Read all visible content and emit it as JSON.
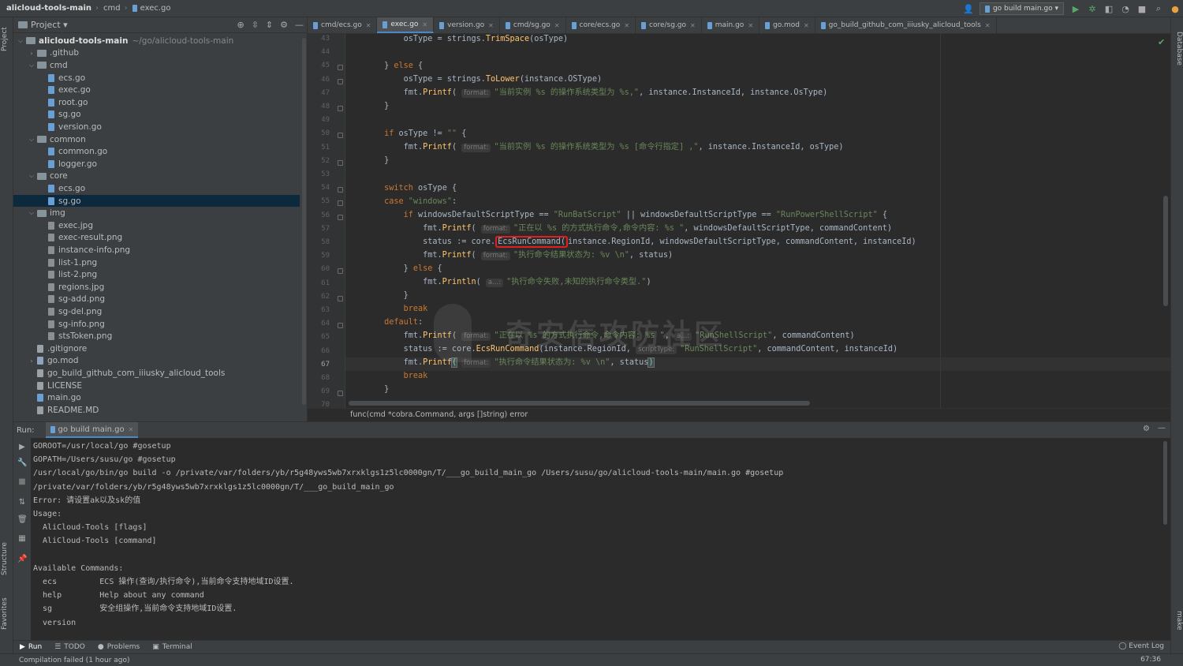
{
  "titlebar": {
    "project": "alicloud-tools-main",
    "folder": "cmd",
    "file": "exec.go",
    "run_config": "go build main.go"
  },
  "side": {
    "project_tab": "Project",
    "structure_tab": "Structure",
    "favorites_tab": "Favorites",
    "database_tab": "Database",
    "make_tab": "make"
  },
  "project_panel": {
    "title": "Project",
    "tree": [
      {
        "label": "alicloud-tools-main",
        "path": "~/go/alicloud-tools-main",
        "type": "folder",
        "depth": 0,
        "open": true
      },
      {
        "label": ".github",
        "type": "folder",
        "depth": 1,
        "open": false
      },
      {
        "label": "cmd",
        "type": "folder",
        "depth": 1,
        "open": true
      },
      {
        "label": "ecs.go",
        "type": "go",
        "depth": 2
      },
      {
        "label": "exec.go",
        "type": "go",
        "depth": 2
      },
      {
        "label": "root.go",
        "type": "go",
        "depth": 2
      },
      {
        "label": "sg.go",
        "type": "go",
        "depth": 2
      },
      {
        "label": "version.go",
        "type": "go",
        "depth": 2
      },
      {
        "label": "common",
        "type": "folder",
        "depth": 1,
        "open": true
      },
      {
        "label": "common.go",
        "type": "go",
        "depth": 2
      },
      {
        "label": "logger.go",
        "type": "go",
        "depth": 2
      },
      {
        "label": "core",
        "type": "folder",
        "depth": 1,
        "open": true
      },
      {
        "label": "ecs.go",
        "type": "go",
        "depth": 2
      },
      {
        "label": "sg.go",
        "type": "go",
        "depth": 2,
        "selected": true
      },
      {
        "label": "img",
        "type": "folder",
        "depth": 1,
        "open": true
      },
      {
        "label": "exec.jpg",
        "type": "img",
        "depth": 2
      },
      {
        "label": "exec-result.png",
        "type": "img",
        "depth": 2
      },
      {
        "label": "instance-info.png",
        "type": "img",
        "depth": 2
      },
      {
        "label": "list-1.png",
        "type": "img",
        "depth": 2
      },
      {
        "label": "list-2.png",
        "type": "img",
        "depth": 2
      },
      {
        "label": "regions.jpg",
        "type": "img",
        "depth": 2
      },
      {
        "label": "sg-add.png",
        "type": "img",
        "depth": 2
      },
      {
        "label": "sg-del.png",
        "type": "img",
        "depth": 2
      },
      {
        "label": "sg-info.png",
        "type": "img",
        "depth": 2
      },
      {
        "label": "stsToken.png",
        "type": "img",
        "depth": 2
      },
      {
        "label": ".gitignore",
        "type": "txt",
        "depth": 1
      },
      {
        "label": "go.mod",
        "type": "mod",
        "depth": 1,
        "open": false
      },
      {
        "label": "go_build_github_com_iiiusky_alicloud_tools",
        "type": "txt",
        "depth": 1
      },
      {
        "label": "LICENSE",
        "type": "txt",
        "depth": 1
      },
      {
        "label": "main.go",
        "type": "go",
        "depth": 1
      },
      {
        "label": "README.MD",
        "type": "txt",
        "depth": 1
      }
    ]
  },
  "tabs": [
    {
      "label": "cmd/ecs.go",
      "active": false
    },
    {
      "label": "exec.go",
      "active": true
    },
    {
      "label": "version.go",
      "active": false
    },
    {
      "label": "cmd/sg.go",
      "active": false
    },
    {
      "label": "core/ecs.go",
      "active": false
    },
    {
      "label": "core/sg.go",
      "active": false
    },
    {
      "label": "main.go",
      "active": false
    },
    {
      "label": "go.mod",
      "active": false
    },
    {
      "label": "go_build_github_com_iiiusky_alicloud_tools",
      "active": false
    }
  ],
  "editor": {
    "line_numbers": [
      "43",
      "44",
      "45",
      "46",
      "47",
      "48",
      "49",
      "50",
      "51",
      "52",
      "53",
      "54",
      "55",
      "56",
      "57",
      "58",
      "59",
      "60",
      "61",
      "62",
      "63",
      "64",
      "65",
      "66",
      "67",
      "68",
      "69",
      "70"
    ],
    "current_line": "67",
    "breadcrumb": "func(cmd *cobra.Command, args []string) error",
    "watermark": "奇安信攻防社区"
  },
  "run": {
    "label": "Run:",
    "tab": "go build main.go",
    "console": [
      "GOROOT=/usr/local/go #gosetup",
      "GOPATH=/Users/susu/go #gosetup",
      "/usr/local/go/bin/go build -o /private/var/folders/yb/r5g48yws5wb7xrxklgs1z5lc0000gn/T/___go_build_main_go /Users/susu/go/alicloud-tools-main/main.go #gosetup",
      "/private/var/folders/yb/r5g48yws5wb7xrxklgs1z5lc0000gn/T/___go_build_main_go",
      "Error: 请设置ak以及sk的值",
      "Usage:",
      "  AliCloud-Tools [flags]",
      "  AliCloud-Tools [command]",
      "",
      "Available Commands:",
      "  ecs         ECS 操作(查询/执行命令),当前命令支持地域ID设置.",
      "  help        Help about any command",
      "  sg          安全组操作,当前命令支持地域ID设置.",
      "  version"
    ]
  },
  "bottom_tabs": {
    "run": "Run",
    "todo": "TODO",
    "problems": "Problems",
    "terminal": "Terminal",
    "event_log": "Event Log"
  },
  "status": {
    "message": "Compilation failed (1 hour ago)",
    "position": "67:36"
  }
}
